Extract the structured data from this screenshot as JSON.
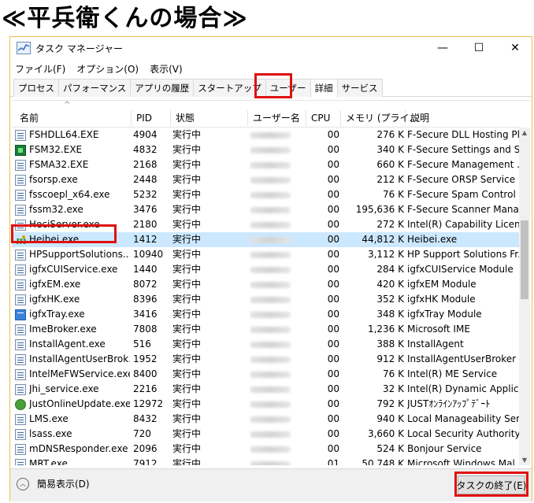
{
  "headline": "≪平兵衛くんの場合≫",
  "window": {
    "title": "タスク マネージャー",
    "controls": {
      "minimize": "—",
      "maximize": "☐",
      "close": "✕"
    }
  },
  "menu": [
    "ファイル(F)",
    "オプション(O)",
    "表示(V)"
  ],
  "tabs": [
    "プロセス",
    "パフォーマンス",
    "アプリの履歴",
    "スタートアップ",
    "ユーザー",
    "詳細",
    "サービス"
  ],
  "active_tab": "詳細",
  "columns": {
    "name": "名前",
    "pid": "PID",
    "status": "状態",
    "user": "ユーザー名",
    "cpu": "CPU",
    "memory": "メモリ (プライ...",
    "description": "説明"
  },
  "rows": [
    {
      "name": "FSHDLL64.EXE",
      "pid": "4904",
      "status": "実行中",
      "cpu": "00",
      "mem": "276 K",
      "desc": "F-Secure DLL Hosting Pl...",
      "icon": "app-icon"
    },
    {
      "name": "FSM32.EXE",
      "pid": "4832",
      "status": "実行中",
      "cpu": "00",
      "mem": "340 K",
      "desc": "F-Secure Settings and St...",
      "icon": "fsecure-icon"
    },
    {
      "name": "FSMA32.EXE",
      "pid": "2168",
      "status": "実行中",
      "cpu": "00",
      "mem": "660 K",
      "desc": "F-Secure Management ...",
      "icon": "app-icon"
    },
    {
      "name": "fsorsp.exe",
      "pid": "2448",
      "status": "実行中",
      "cpu": "00",
      "mem": "212 K",
      "desc": "F-Secure ORSP Service",
      "icon": "app-icon"
    },
    {
      "name": "fsscoepl_x64.exe",
      "pid": "5232",
      "status": "実行中",
      "cpu": "00",
      "mem": "76 K",
      "desc": "F-Secure Spam Control ...",
      "icon": "app-icon"
    },
    {
      "name": "fssm32.exe",
      "pid": "3476",
      "status": "実行中",
      "cpu": "00",
      "mem": "195,636 K",
      "desc": "F-Secure Scanner Mana...",
      "icon": "app-icon"
    },
    {
      "name": "HeciServer.exe",
      "pid": "2180",
      "status": "実行中",
      "cpu": "00",
      "mem": "272 K",
      "desc": "Intel(R) Capability Licen...",
      "icon": "app-icon"
    },
    {
      "name": "Heibei.exe",
      "pid": "1412",
      "status": "実行中",
      "cpu": "00",
      "mem": "44,812 K",
      "desc": "Heibei.exe",
      "icon": "heibei-logo-icon"
    },
    {
      "name": "HPSupportSolutions...",
      "pid": "10940",
      "status": "実行中",
      "cpu": "00",
      "mem": "3,112 K",
      "desc": "HP Support Solutions Fr...",
      "icon": "app-icon"
    },
    {
      "name": "igfxCUIService.exe",
      "pid": "1440",
      "status": "実行中",
      "cpu": "00",
      "mem": "284 K",
      "desc": "igfxCUIService Module",
      "icon": "app-icon"
    },
    {
      "name": "igfxEM.exe",
      "pid": "8072",
      "status": "実行中",
      "cpu": "00",
      "mem": "420 K",
      "desc": "igfxEM Module",
      "icon": "app-icon"
    },
    {
      "name": "igfxHK.exe",
      "pid": "8396",
      "status": "実行中",
      "cpu": "00",
      "mem": "352 K",
      "desc": "igfxHK Module",
      "icon": "app-icon"
    },
    {
      "name": "igfxTray.exe",
      "pid": "3416",
      "status": "実行中",
      "cpu": "00",
      "mem": "348 K",
      "desc": "igfxTray Module",
      "icon": "tray-icon"
    },
    {
      "name": "ImeBroker.exe",
      "pid": "7808",
      "status": "実行中",
      "cpu": "00",
      "mem": "1,236 K",
      "desc": "Microsoft IME",
      "icon": "app-icon"
    },
    {
      "name": "InstallAgent.exe",
      "pid": "516",
      "status": "実行中",
      "cpu": "00",
      "mem": "388 K",
      "desc": "InstallAgent",
      "icon": "app-icon"
    },
    {
      "name": "InstallAgentUserBrok...",
      "pid": "1952",
      "status": "実行中",
      "cpu": "00",
      "mem": "912 K",
      "desc": "InstallAgentUserBroker",
      "icon": "app-icon"
    },
    {
      "name": "IntelMeFWService.exe",
      "pid": "8400",
      "status": "実行中",
      "cpu": "00",
      "mem": "76 K",
      "desc": "Intel(R) ME Service",
      "icon": "app-icon"
    },
    {
      "name": "Jhi_service.exe",
      "pid": "2216",
      "status": "実行中",
      "cpu": "00",
      "mem": "32 K",
      "desc": "Intel(R) Dynamic Applic...",
      "icon": "app-icon"
    },
    {
      "name": "JustOnlineUpdate.exe",
      "pid": "12972",
      "status": "実行中",
      "cpu": "00",
      "mem": "792 K",
      "desc": "JUSTｵﾝﾗｲﾝｱｯﾌﾟﾃﾞｰﾄ",
      "icon": "globe-icon"
    },
    {
      "name": "LMS.exe",
      "pid": "8432",
      "status": "実行中",
      "cpu": "00",
      "mem": "940 K",
      "desc": "Local Manageability Ser...",
      "icon": "app-icon"
    },
    {
      "name": "lsass.exe",
      "pid": "720",
      "status": "実行中",
      "cpu": "00",
      "mem": "3,660 K",
      "desc": "Local Security Authority...",
      "icon": "app-icon"
    },
    {
      "name": "mDNSResponder.exe",
      "pid": "2096",
      "status": "実行中",
      "cpu": "00",
      "mem": "524 K",
      "desc": "Bonjour Service",
      "icon": "app-icon"
    },
    {
      "name": "MRT.exe",
      "pid": "7912",
      "status": "実行中",
      "cpu": "01",
      "mem": "50,748 K",
      "desc": "Microsoft Windows Mal...",
      "icon": "app-icon"
    }
  ],
  "selected_row": "Heibei.exe",
  "footer": {
    "fewer_details": "簡易表示(D)",
    "end_task": "タスクの終了(E)"
  }
}
